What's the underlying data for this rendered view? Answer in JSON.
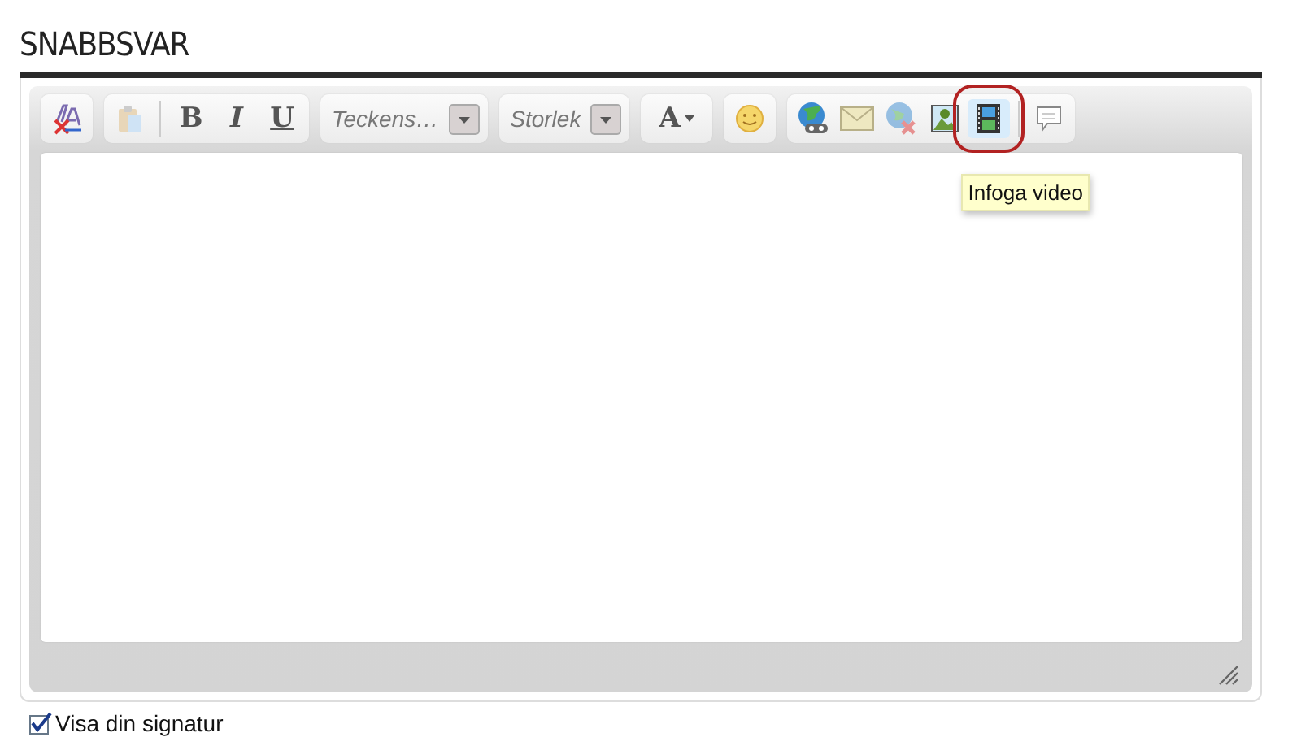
{
  "heading": "SNABBSVAR",
  "toolbar": [
    {
      "items": [
        {
          "kind": "icon",
          "selected": false
        }
      ]
    },
    {
      "items": [
        {
          "kind": "icon",
          "selected": false
        },
        {
          "kind": "separator"
        },
        {
          "kind": "bold",
          "label": "B"
        },
        {
          "kind": "italic",
          "label": "I"
        },
        {
          "kind": "underline",
          "label": "U"
        }
      ]
    },
    {
      "items": [
        {
          "kind": "dropdown",
          "label": "Teckens…"
        }
      ]
    },
    {
      "items": [
        {
          "kind": "dropdown",
          "label": "Storlek"
        }
      ]
    },
    {
      "items": [
        {
          "kind": "color",
          "label": "A"
        }
      ]
    },
    {
      "items": [
        {
          "kind": "icon",
          "selected": false
        }
      ]
    },
    {
      "items": [
        {
          "kind": "icon",
          "selected": false
        },
        {
          "kind": "icon",
          "selected": false
        },
        {
          "kind": "icon",
          "selected": false
        },
        {
          "kind": "icon",
          "selected": false
        },
        {
          "kind": "icon",
          "selected": true,
          "tooltip": "Infoga video"
        },
        {
          "kind": "separator"
        },
        {
          "kind": "icon",
          "selected": false
        }
      ]
    }
  ],
  "signature": {
    "label": "Visa din signatur",
    "checked": true
  }
}
